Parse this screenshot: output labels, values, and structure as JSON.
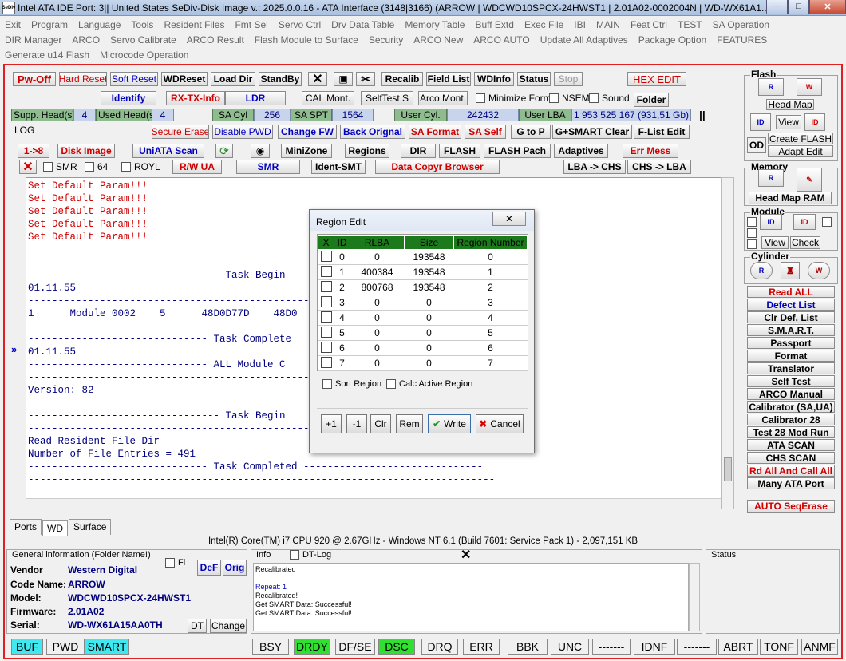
{
  "window": {
    "title": "Intel ATA IDE  Port: 3|| United States  SeDiv-Disk Image v.: 2025.0.0.16 - ATA Interface (3148|3166)  (ARROW | WDCWD10SPCX-24HWST1 | 2.01A02-0002004N | WD-WX61A1...",
    "icon_text": "SeDiv",
    "minimize": "─",
    "maximize": "□",
    "close": "✕"
  },
  "menu": [
    "Exit",
    "Program",
    "Language",
    "Tools",
    "Resident Files",
    "Fmt Sel",
    "Servo Ctrl",
    "Drv Data Table",
    "Memory Table",
    "Buff Extd",
    "Exec File",
    "IBI",
    "MAIN",
    "Feat Ctrl",
    "TEST",
    "SA Operation",
    "DIR Manager",
    "ARCO",
    "Servo Calibrate",
    "ARCO Result",
    "Flash Module to Surface",
    "Security",
    "ARCO New",
    "ARCO AUTO",
    "Update All Adaptives",
    "Package Option",
    "FEATURES",
    "Generate u14 Flash",
    "Microcode Operation"
  ],
  "toolbar": {
    "pw_off": "Pw-Off",
    "hard_reset": "Hard Reset",
    "soft_reset": "Soft Reset",
    "wd_reset": "WDReset",
    "load_dir": "Load Dir",
    "standby": "StandBy",
    "recalib": "Recalib",
    "field_list": "Field List",
    "wdinfo": "WDInfo",
    "status": "Status",
    "stop": "Stop",
    "hex_edit": "HEX EDIT",
    "identify": "Identify",
    "rx_tx_info": "RX-TX-Info",
    "ldr": "LDR",
    "cal_mont": "CAL Mont.",
    "selftest_s": "SelfTest S",
    "arco_mont": "Arco Mont.",
    "minimize_form": "Minimize Form",
    "nsem": "NSEM",
    "sound": "Sound",
    "folder": "Folder",
    "supp_heads_label": "Supp. Head(s)",
    "supp_heads_val": "4",
    "used_heads_label": "Used Head(s)",
    "used_heads_val": "4",
    "sa_cyl_label": "SA Cyl",
    "sa_cyl_val": "256",
    "sa_spt_label": "SA SPT",
    "sa_spt_val": "1564",
    "user_cyl_label": "User Cyl.",
    "user_cyl_val": "242432",
    "user_lba_label": "User LBA",
    "user_lba_val": "1 953 525 167  (931,51 Gb)",
    "pause": "||",
    "log_label": "LOG",
    "secure_erase": "Secure Erase",
    "disable_pwd": "Disable PWD",
    "change_fw": "Change FW",
    "back_orignal": "Back Orignal",
    "sa_format": "SA Format",
    "sa_self": "SA Self",
    "g_to_p": "G to P",
    "gsmart_clear": "G+SMART Clear",
    "flist_edit": "F-List Edit",
    "one_to_eight": "1->8",
    "disk_image": "Disk Image",
    "uniata_scan": "UniATA Scan",
    "minizone": "MiniZone",
    "regions": "Regions",
    "dir": "DIR",
    "flash": "FLASH",
    "flash_pach": "FLASH Pach",
    "adaptives": "Adaptives",
    "err_mess": "Err Mess",
    "smr_cb": "SMR",
    "cb64": "64",
    "royl": "ROYL",
    "rw_ua": "R/W UA",
    "smr": "SMR",
    "ident_smt": "Ident-SMT",
    "data_copyr": "Data Copyr Browser",
    "lba_chs": "LBA -> CHS",
    "chs_lba": "CHS -> LBA"
  },
  "log_lines": [
    {
      "t": "Set Default Param!!!",
      "c": "red"
    },
    {
      "t": "Set Default Param!!!",
      "c": "red"
    },
    {
      "t": "Set Default Param!!!",
      "c": "red"
    },
    {
      "t": "Set Default Param!!!",
      "c": "red"
    },
    {
      "t": "Set Default Param!!!",
      "c": "red"
    },
    {
      "t": "",
      "c": "blue"
    },
    {
      "t": "",
      "c": "blue"
    },
    {
      "t": "-------------------------------- Task Begin",
      "c": "blue"
    },
    {
      "t": "01.11.55",
      "c": "blue"
    },
    {
      "t": "---------------------------------------------------",
      "c": "blue"
    },
    {
      "t": "1      Module 0002    5      48D0D77D    48D0",
      "c": "blue"
    },
    {
      "t": "",
      "c": "blue"
    },
    {
      "t": "------------------------------ Task Complete",
      "c": "blue"
    },
    {
      "t": "01.11.55",
      "c": "blue"
    },
    {
      "t": "------------------------------ ALL Module C",
      "c": "blue"
    },
    {
      "t": "---------------------------------------------------",
      "c": "blue"
    },
    {
      "t": "Version: 82",
      "c": "blue"
    },
    {
      "t": "",
      "c": "blue"
    },
    {
      "t": "-------------------------------- Task Begin",
      "c": "blue"
    },
    {
      "t": "---------------------------------------------------",
      "c": "blue"
    },
    {
      "t": "Read Resident File Dir",
      "c": "blue"
    },
    {
      "t": "Number of File Entries = 491",
      "c": "blue"
    },
    {
      "t": "------------------------------ Task Completed ------------------------------",
      "c": "blue"
    },
    {
      "t": "------------------------------------------------------------------------------",
      "c": "blue"
    }
  ],
  "side_arrow": "»",
  "right_panel": {
    "flash_title": "Flash",
    "head_map": "Head Map",
    "view": "View",
    "create_flash": "Create FLASH",
    "od": "OD",
    "adapt_edit": "Adapt Edit",
    "memory_title": "Memory",
    "head_map_ram": "Head Map RAM",
    "module_title": "Module",
    "view2": "View",
    "check": "Check",
    "cylinder_title": "Cylinder",
    "icon_r": "R",
    "icon_w": "W",
    "icon_id": "ID",
    "buttons": [
      {
        "label": "Read ALL",
        "color": "red"
      },
      {
        "label": "Defect List",
        "color": "blue"
      },
      {
        "label": "Clr Def. List",
        "color": "black"
      },
      {
        "label": "S.M.A.R.T.",
        "color": "black"
      },
      {
        "label": "Passport",
        "color": "black"
      },
      {
        "label": "Format",
        "color": "black"
      },
      {
        "label": "Translator",
        "color": "black"
      },
      {
        "label": "Self Test",
        "color": "black"
      },
      {
        "label": "ARCO Manual",
        "color": "black"
      },
      {
        "label": "Calibrator (SA,UA)",
        "color": "black"
      },
      {
        "label": "Calibrator 28",
        "color": "black"
      },
      {
        "label": "Test 28 Mod Run",
        "color": "black"
      },
      {
        "label": "ATA SCAN",
        "color": "black"
      },
      {
        "label": "CHS SCAN",
        "color": "black"
      },
      {
        "label": "Rd All And Call All",
        "color": "red"
      },
      {
        "label": "Many ATA Port",
        "color": "black"
      }
    ],
    "auto_seq_erase": "AUTO SeqErase"
  },
  "region_dialog": {
    "title": "Region Edit",
    "close": "✕",
    "columns": [
      "X",
      "ID",
      "RLBA",
      "Size",
      "Region Number"
    ],
    "rows": [
      {
        "id": "0",
        "rlba": "0",
        "size": "193548",
        "num": "0"
      },
      {
        "id": "1",
        "rlba": "400384",
        "size": "193548",
        "num": "1"
      },
      {
        "id": "2",
        "rlba": "800768",
        "size": "193548",
        "num": "2"
      },
      {
        "id": "3",
        "rlba": "0",
        "size": "0",
        "num": "3"
      },
      {
        "id": "4",
        "rlba": "0",
        "size": "0",
        "num": "4"
      },
      {
        "id": "5",
        "rlba": "0",
        "size": "0",
        "num": "5"
      },
      {
        "id": "6",
        "rlba": "0",
        "size": "0",
        "num": "6"
      },
      {
        "id": "7",
        "rlba": "0",
        "size": "0",
        "num": "7"
      }
    ],
    "sort_region": "Sort Region",
    "calc_active_region": "Calc Active Region",
    "plus1": "+1",
    "minus1": "-1",
    "clr": "Clr",
    "rem": "Rem",
    "write": "Write",
    "cancel": "Cancel"
  },
  "tabs": [
    "Ports",
    "WD",
    "Surface"
  ],
  "cpu_line": "Intel(R) Core(TM) i7 CPU 920  @ 2.67GHz - Windows NT 6.1 (Build 7601: Service Pack 1) - 2,097,151 KB",
  "general_info": {
    "title": "General information (Folder Name!)",
    "fl": "Fl",
    "def": "DeF",
    "orig": "Orig",
    "vendor_label": "Vendor",
    "vendor": "Western Digital",
    "codename_label": "Code Name:",
    "codename": "ARROW",
    "model_label": "Model:",
    "model": "WDCWD10SPCX-24HWST1",
    "firmware_label": "Firmware:",
    "firmware": "2.01A02",
    "serial_label": "Serial:",
    "serial": "WD-WX61A15AA0TH",
    "dt": "DT",
    "change": "Change"
  },
  "info_panel": {
    "info_label": "Info",
    "dtlog_label": "DT-Log",
    "close": "✕",
    "lines": [
      {
        "t": "Recalibrated",
        "c": "black"
      },
      {
        "t": "",
        "c": "black"
      },
      {
        "t": "Repeat: 1",
        "c": "blue"
      },
      {
        "t": "Recalibrated!",
        "c": "black"
      },
      {
        "t": "Get SMART Data: Successful!",
        "c": "black"
      },
      {
        "t": "Get SMART Data: Successful!",
        "c": "black"
      }
    ]
  },
  "status_label": "Status",
  "status_flags": [
    {
      "label": "BUF",
      "bg": "cyan"
    },
    {
      "label": "PWD",
      "bg": "none"
    },
    {
      "label": "SMART",
      "bg": "cyan"
    },
    {
      "label": "BSY",
      "bg": "none"
    },
    {
      "label": "DRDY",
      "bg": "lime"
    },
    {
      "label": "DF/SE",
      "bg": "none"
    },
    {
      "label": "DSC",
      "bg": "lime"
    },
    {
      "label": "DRQ",
      "bg": "none"
    },
    {
      "label": "ERR",
      "bg": "none"
    },
    {
      "label": "BBK",
      "bg": "none"
    },
    {
      "label": "UNC",
      "bg": "none"
    },
    {
      "label": "-------",
      "bg": "none"
    },
    {
      "label": "IDNF",
      "bg": "none"
    },
    {
      "label": "-------",
      "bg": "none"
    },
    {
      "label": "ABRT",
      "bg": "none"
    },
    {
      "label": "TONF",
      "bg": "none"
    },
    {
      "label": "ANMF",
      "bg": "none"
    }
  ]
}
